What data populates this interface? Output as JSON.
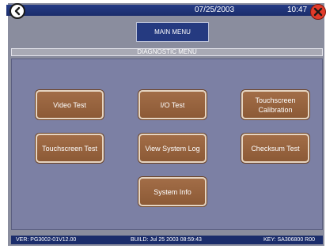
{
  "topbar": {
    "date": "07/25/2003",
    "time": "10:47"
  },
  "nav": {
    "main_menu_label": "MAIN MENU"
  },
  "section": {
    "title": "DIAGNOSTIC MENU"
  },
  "buttons": {
    "video_test": "Video Test",
    "io_test": "I/O Test",
    "touchscreen_calibration": "Touchscreen Calibration",
    "touchscreen_test": "Touchscreen Test",
    "view_system_log": "View System Log",
    "checksum_test": "Checksum Test",
    "system_info": "System Info"
  },
  "status": {
    "version": "VER: PG3002-01V12.00",
    "build": "BUILD: Jul 25 2003  08:59:43",
    "key": "KEY: SA306800 R00"
  },
  "colors": {
    "background": "#8a8d9e",
    "topbar": "#1b2d6b",
    "panel": "#7c80a4",
    "button": "#9a6540",
    "close": "#e23b2a"
  },
  "icons": {
    "back": "back-arrow-icon",
    "close": "close-x-icon"
  }
}
